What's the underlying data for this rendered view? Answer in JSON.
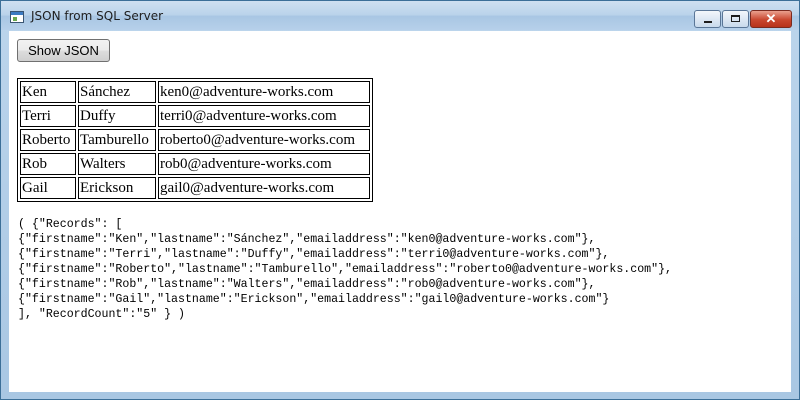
{
  "window": {
    "title": "JSON from SQL Server"
  },
  "toolbar": {
    "show_json_label": "Show JSON"
  },
  "records_table": {
    "rows": [
      {
        "firstname": "Ken",
        "lastname": "Sánchez",
        "email": "ken0@adventure-works.com"
      },
      {
        "firstname": "Terri",
        "lastname": "Duffy",
        "email": "terri0@adventure-works.com"
      },
      {
        "firstname": "Roberto",
        "lastname": "Tamburello",
        "email": "roberto0@adventure-works.com"
      },
      {
        "firstname": "Rob",
        "lastname": "Walters",
        "email": "rob0@adventure-works.com"
      },
      {
        "firstname": "Gail",
        "lastname": "Erickson",
        "email": "gail0@adventure-works.com"
      }
    ]
  },
  "json_output": {
    "text": "( {\"Records\": [\n{\"firstname\":\"Ken\",\"lastname\":\"Sánchez\",\"emailaddress\":\"ken0@adventure-works.com\"},\n{\"firstname\":\"Terri\",\"lastname\":\"Duffy\",\"emailaddress\":\"terri0@adventure-works.com\"},\n{\"firstname\":\"Roberto\",\"lastname\":\"Tamburello\",\"emailaddress\":\"roberto0@adventure-works.com\"},\n{\"firstname\":\"Rob\",\"lastname\":\"Walters\",\"emailaddress\":\"rob0@adventure-works.com\"},\n{\"firstname\":\"Gail\",\"lastname\":\"Erickson\",\"emailaddress\":\"gail0@adventure-works.com\"}\n], \"RecordCount\":\"5\" } )"
  },
  "icons": {
    "app": "window-app-icon",
    "minimize": "minimize-icon",
    "maximize": "maximize-icon",
    "close": "close-icon"
  }
}
